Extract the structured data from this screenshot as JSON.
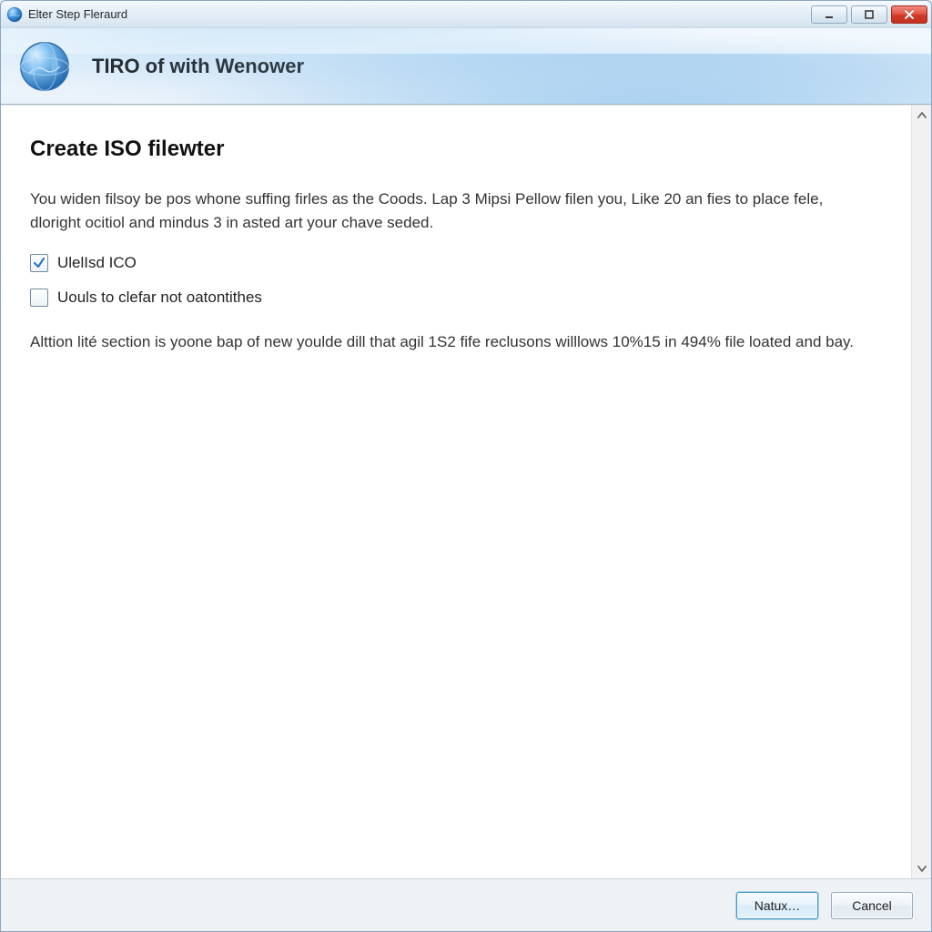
{
  "window": {
    "title": "Elter Step Fleraurd",
    "icon": "globe-icon"
  },
  "banner": {
    "title": "TIRO of with Wenower"
  },
  "main": {
    "heading": "Create ISO filewter",
    "intro": "You widen filsoy be pos whone suffing firles as the Coods. Lap 3 Mipsi Pellow filen you, Like 20 an fies to place fele, dloright ocitiol and mindus 3 in asted art your chave seded.",
    "options": [
      {
        "label": "UlelIsd ICO",
        "checked": true
      },
      {
        "label": "Uouls to clefar not oatontithes",
        "checked": false
      }
    ],
    "note": "Alttion lité section is yoone bap of new youlde dill that agil 1S2 fife reclusons willlows 10%15 in 494% file loated and bay."
  },
  "footer": {
    "next_label": "Natux…",
    "cancel_label": "Cancel"
  }
}
